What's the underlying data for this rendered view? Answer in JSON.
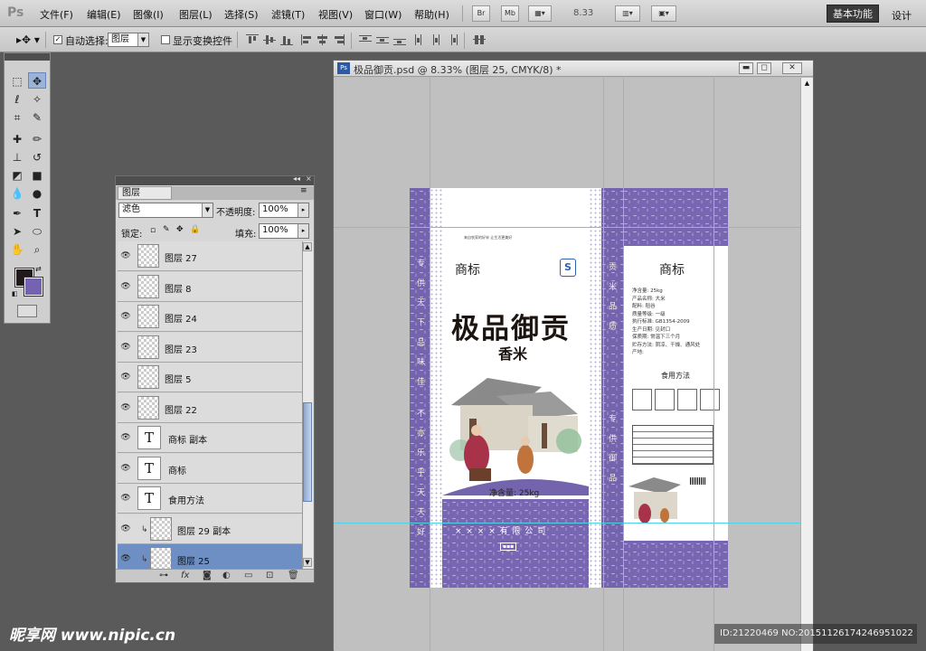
{
  "app": {
    "logo": "Ps"
  },
  "menu": [
    "文件(F)",
    "编辑(E)",
    "图像(I)",
    "图层(L)",
    "选择(S)",
    "滤镜(T)",
    "视图(V)",
    "窗口(W)",
    "帮助(H)"
  ],
  "menubar_buttons": {
    "bridge": "Br",
    "minibridge": "Mb",
    "zoom": "8.33"
  },
  "workspace": {
    "basic": "基本功能",
    "design": "设计"
  },
  "options": {
    "auto_select_label": "自动选择:",
    "auto_select_value": "图层",
    "show_transform_label": "显示变换控件"
  },
  "layers_panel": {
    "tab": "图层",
    "blend_mode": "滤色",
    "opacity_label": "不透明度:",
    "opacity_value": "100%",
    "lock_label": "锁定:",
    "fill_label": "填充:",
    "fill_value": "100%",
    "layers": [
      {
        "name": "图层 27",
        "kind": "pixel",
        "selected": false
      },
      {
        "name": "图层 8",
        "kind": "pixel",
        "selected": false
      },
      {
        "name": "图层 24",
        "kind": "pixel",
        "selected": false
      },
      {
        "name": "图层 23",
        "kind": "pixel",
        "selected": false
      },
      {
        "name": "图层 5",
        "kind": "pixel",
        "selected": false
      },
      {
        "name": "图层 22",
        "kind": "pixel",
        "selected": false
      },
      {
        "name": "商标 副本",
        "kind": "text",
        "selected": false
      },
      {
        "name": "商标",
        "kind": "text",
        "selected": false
      },
      {
        "name": "食用方法",
        "kind": "text",
        "selected": false
      },
      {
        "name": "图层 29 副本",
        "kind": "pixel",
        "selected": false,
        "clipped": true
      },
      {
        "name": "图层 25",
        "kind": "pixel",
        "selected": true,
        "clipped": true
      }
    ]
  },
  "document": {
    "title": "极品御贡.psd @ 8.33% (图层 25, CMYK/8) *"
  },
  "package": {
    "title": "极品御贡",
    "subtitle": "香米",
    "brand_front": "商标",
    "brand_back": "商标",
    "net_weight": "净含量: 25kg",
    "usage_title": "食用方法",
    "company": "× × × × 有 限 公 司",
    "side_text_top": "专 供 天 下 品 味 佳",
    "side_text_bottom": "不 亦 乐 乎 天 天 好",
    "side_text_right_top": "贡 米 品 质",
    "side_text_right_bottom": "专 供 御 品",
    "tagline": "来自农家的好米   让生活更美好",
    "specs": [
      "净含量: 25kg",
      "产品名称: 大米",
      "配料: 稻谷",
      "质量等级: 一级",
      "执行标准: GB1354-2009",
      "生产日期: 见封口",
      "保质期: 常温下三个月",
      "贮存方法: 阴凉、干燥、通风处",
      "产地:"
    ]
  },
  "watermark": {
    "logo": "昵享网 www.nipic.cn",
    "id_text": "ID:21220469 NO:20151126174246951022"
  }
}
